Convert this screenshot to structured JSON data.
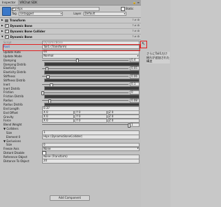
{
  "tabs": {
    "inspector": "Inspector",
    "sdk": "VRChat SDK"
  },
  "object": {
    "name": "Hips",
    "static_label": "Static",
    "tag_label": "Tag",
    "tag_value": "Untagged",
    "layer_label": "Layer",
    "layer_value": "Default"
  },
  "components": [
    {
      "name": "Transform"
    },
    {
      "name": "Dynamic Bone"
    },
    {
      "name": "Dynamic Bone Collider"
    },
    {
      "name": "Dynamic Bone"
    }
  ],
  "fields": {
    "script_label": "Script",
    "script_value": "DynamicBone",
    "root_label": "Root",
    "root_value": "Tail1 (Transform)",
    "update_rate_label": "Update Rate",
    "update_rate_value": "60",
    "update_mode_label": "Update Mode",
    "update_mode_value": "Normal",
    "damping_label": "Damping",
    "damping_value": "0.4",
    "damping_distrib_label": "Damping Distrib",
    "elasticity_label": "Elasticity",
    "elasticity_value": "0.05",
    "elasticity_distrib_label": "Elasticity Distrib",
    "stiffness_label": "Stiffness",
    "stiffness_value": "0.06",
    "stiffness_distrib_label": "Stiffness Distrib",
    "inert_label": "Inert",
    "inert_value": "0.1",
    "inert_distrib_label": "Inert Distrib",
    "friction_label": "Friction",
    "friction_value": "0",
    "friction_distrib_label": "Friction Distrib",
    "radius_label": "Radius",
    "radius_value": "0.08",
    "radius_distrib_label": "Radius Distrib",
    "end_length_label": "End Length",
    "end_length_value": "0.37",
    "end_offset_label": "End Offset",
    "end_offset_x": "X 0",
    "end_offset_y": "Y 0",
    "end_offset_z": "Z 0",
    "gravity_label": "Gravity",
    "gravity_x": "X 0",
    "gravity_y": "Y 0",
    "gravity_z": "Z 0",
    "force_label": "Force",
    "force_x": "X 0",
    "force_y": "Y 0",
    "force_z": "Z 0",
    "blend_weight_label": "Blend Weight",
    "blend_weight_value": "1",
    "colliders_label": "Colliders",
    "colliders_size_label": "Size",
    "colliders_size_value": "1",
    "colliders_el0_label": "Element 0",
    "colliders_el0_value": "Hips (DynamicBoneCollider)",
    "exclusions_label": "Exclusions",
    "exclusions_size_label": "Size",
    "exclusions_size_value": "0",
    "freeze_axis_label": "Freeze Axis",
    "freeze_axis_value": "None",
    "distant_disable_label": "Distant Disable",
    "reference_object_label": "Reference Object",
    "reference_object_value": "None (Transform)",
    "distance_to_object_label": "Distance To Object",
    "distance_to_object_value": "20"
  },
  "add_component": "Add Component",
  "callout": {
    "line1": "さらにTail1だけ",
    "line2": "揺れが追加された構造"
  },
  "slider_levels": {
    "damping": 0.4,
    "elasticity": 0.05,
    "stiffness": 0.06,
    "inert": 0.1,
    "friction": 0.0,
    "radius": 0.08,
    "blend_weight": 1.0
  },
  "colors": {
    "highlight": "#e02020",
    "header_bg": "#c8c8c8",
    "panel_bg": "#c2c2c2"
  }
}
